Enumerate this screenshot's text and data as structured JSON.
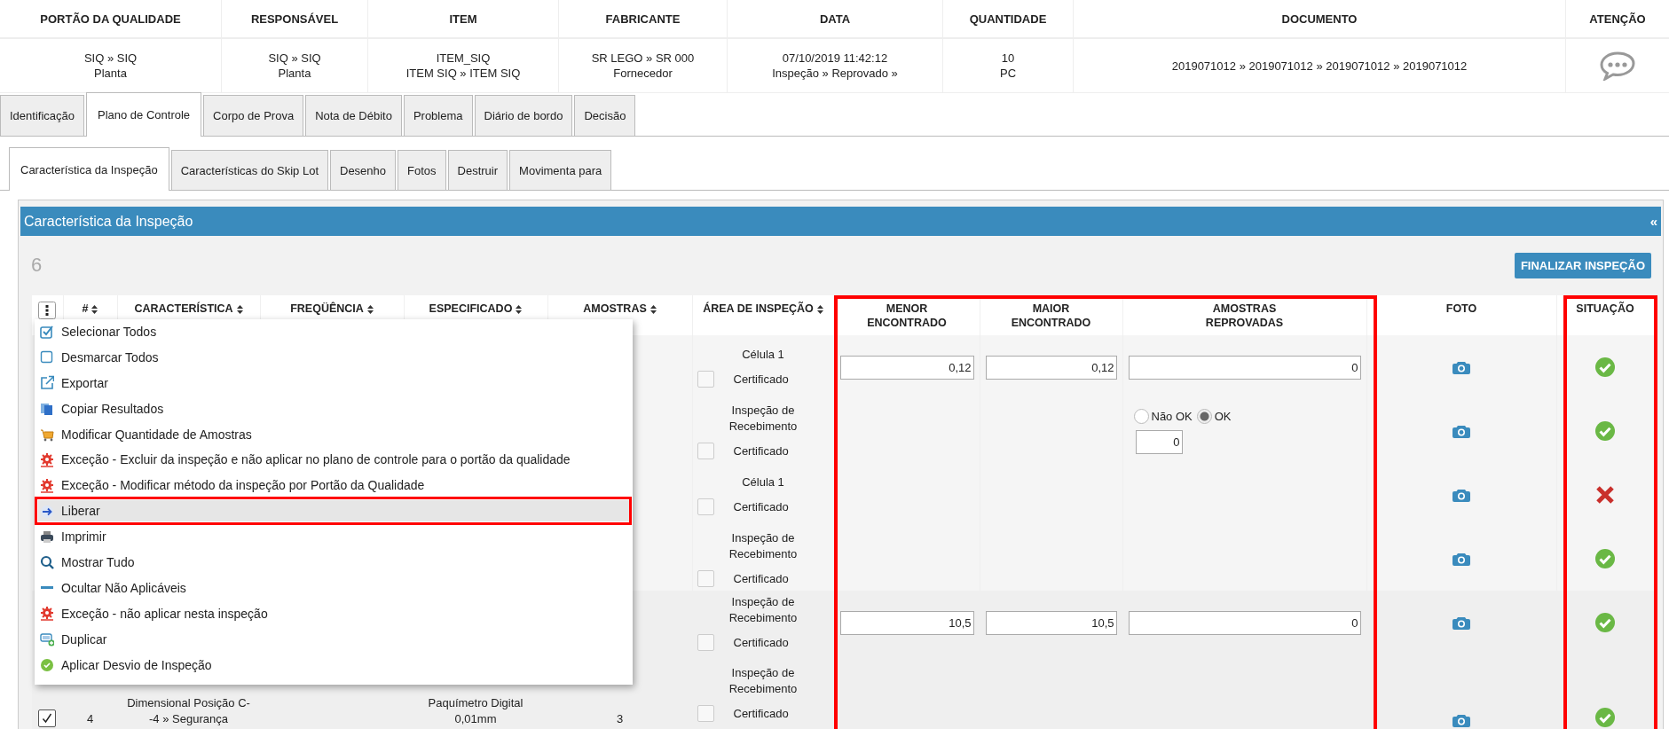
{
  "summary": [
    {
      "kind": "text",
      "label": "PORTÃO DA QUALIDADE",
      "lines": [
        "SIQ » SIQ",
        "Planta"
      ]
    },
    {
      "kind": "text",
      "label": "RESPONSÁVEL",
      "lines": [
        "SIQ » SIQ",
        "Planta"
      ]
    },
    {
      "kind": "text",
      "label": "ITEM",
      "lines": [
        "ITEM_SIQ",
        "ITEM SIQ » ITEM SIQ"
      ]
    },
    {
      "kind": "text",
      "label": "FABRICANTE",
      "lines": [
        "SR LEGO » SR 000",
        "Fornecedor"
      ]
    },
    {
      "kind": "text",
      "label": "DATA",
      "lines": [
        "07/10/2019 11:42:12",
        "Inspeção » Reprovado »"
      ]
    },
    {
      "kind": "text",
      "label": "QUANTIDADE",
      "lines": [
        "10",
        "PC"
      ]
    },
    {
      "kind": "text",
      "label": "DOCUMENTO",
      "lines": [
        "2019071012 » 2019071012 » 2019071012 » 2019071012"
      ]
    },
    {
      "kind": "alert",
      "label": "ATENÇÃO"
    }
  ],
  "tabs": [
    {
      "label": "Identificação",
      "selected": false
    },
    {
      "label": "Plano de Controle",
      "selected": true
    },
    {
      "label": "Corpo de Prova",
      "selected": false
    },
    {
      "label": "Nota de Débito",
      "selected": false
    },
    {
      "label": "Problema",
      "selected": false
    },
    {
      "label": "Diário de bordo",
      "selected": false
    },
    {
      "label": "Decisão",
      "selected": false
    }
  ],
  "subtabs": [
    {
      "label": "Característica da Inspeção",
      "selected": true
    },
    {
      "label": "Características do Skip Lot",
      "selected": false
    },
    {
      "label": "Desenho",
      "selected": false
    },
    {
      "label": "Fotos",
      "selected": false
    },
    {
      "label": "Destruir",
      "selected": false
    },
    {
      "label": "Movimenta para",
      "selected": false
    }
  ],
  "panel": {
    "title": "Característica da Inspeção",
    "collapse": "«",
    "count": "6",
    "finish_button": "FINALIZAR INSPEÇÃO"
  },
  "table": {
    "columns": [
      {
        "kind": "menu"
      },
      {
        "kind": "label",
        "label": "#",
        "sortable": true,
        "annotated": false
      },
      {
        "kind": "label",
        "label": "CARACTERÍSTICA",
        "sortable": true,
        "annotated": false
      },
      {
        "kind": "label",
        "label": "FREQÜÊNCIA",
        "sortable": true,
        "annotated": false
      },
      {
        "kind": "label",
        "label": "ESPECIFICADO",
        "sortable": true,
        "annotated": false
      },
      {
        "kind": "label",
        "label": "AMOSTRAS",
        "sortable": true,
        "annotated": false
      },
      {
        "kind": "label",
        "label": "ÁREA DE INSPEÇÃO",
        "sortable": true,
        "annotated": false
      },
      {
        "kind": "label",
        "label": "MENOR ENCONTRADO",
        "sortable": false,
        "annotated": true
      },
      {
        "kind": "label",
        "label": "MAIOR ENCONTRADO",
        "sortable": false,
        "annotated": true
      },
      {
        "kind": "label",
        "label": "AMOSTRAS REPROVADAS",
        "sortable": false,
        "annotated": true
      },
      {
        "kind": "label",
        "label": "FOTO",
        "sortable": false,
        "annotated": false
      },
      {
        "kind": "label",
        "label": "SITUAÇÃO",
        "sortable": false,
        "annotated": true
      }
    ],
    "rows": [
      {
        "kind": "numeric",
        "area": "Célula 1",
        "certificate": "Certificado",
        "certified": false,
        "min": "0,12",
        "max": "0,12",
        "rejected": "0",
        "approved": true
      },
      {
        "kind": "attribute",
        "area": "Inspeção de Recebimento",
        "certificate": "Certificado",
        "certified": false,
        "options": [
          {
            "label": "Não OK",
            "selected": false
          },
          {
            "label": "OK",
            "selected": true
          }
        ],
        "rejected": "0",
        "approved": true
      },
      {
        "kind": "blank",
        "area": "Célula 1",
        "certificate": "Certificado",
        "certified": false,
        "approved": false
      },
      {
        "kind": "blank",
        "area": "Inspeção de Recebimento",
        "certificate": "Certificado",
        "certified": false,
        "approved": true
      },
      {
        "kind": "numeric",
        "area": "Inspeção de Recebimento",
        "certificate": "Certificado",
        "certified": false,
        "min": "10,5",
        "max": "10,5",
        "rejected": "0",
        "approved": true
      },
      {
        "kind": "blank",
        "checked": true,
        "number": "4",
        "characteristic": [
          "Dimensional Posição C-",
          "-4 » Segurança"
        ],
        "specified": [
          "Paquímetro Digital",
          "0,01mm"
        ],
        "samples": "3",
        "area": "Inspeção de Recebimento",
        "certificate": "Certificado",
        "certified": false,
        "approved": true
      }
    ]
  },
  "menu": [
    {
      "kind": "select-all",
      "label": "Selecionar Todos",
      "selected": false,
      "annotated": false
    },
    {
      "kind": "deselect-all",
      "label": "Desmarcar Todos",
      "selected": false,
      "annotated": false
    },
    {
      "kind": "export",
      "label": "Exportar",
      "selected": false,
      "annotated": false
    },
    {
      "kind": "copy",
      "label": "Copiar Resultados",
      "selected": false,
      "annotated": false
    },
    {
      "kind": "quantity",
      "label": "Modificar Quantidade de Amostras",
      "selected": false,
      "annotated": false
    },
    {
      "kind": "exception",
      "label": "Exceção - Excluir da inspeção e não aplicar no plano de controle para o portão da qualidade",
      "selected": false,
      "annotated": false
    },
    {
      "kind": "exception",
      "label": "Exceção - Modificar método da inspeção por Portão da Qualidade",
      "selected": false,
      "annotated": false
    },
    {
      "kind": "release",
      "label": "Liberar",
      "selected": true,
      "annotated": true
    },
    {
      "kind": "print",
      "label": "Imprimir",
      "selected": false,
      "annotated": false
    },
    {
      "kind": "show",
      "label": "Mostrar Tudo",
      "selected": false,
      "annotated": false
    },
    {
      "kind": "hide",
      "label": "Ocultar Não Aplicáveis",
      "selected": false,
      "annotated": false
    },
    {
      "kind": "exception",
      "label": "Exceção - não aplicar nesta inspeção",
      "selected": false,
      "annotated": false
    },
    {
      "kind": "duplicate",
      "label": "Duplicar",
      "selected": false,
      "annotated": false
    },
    {
      "kind": "deviation",
      "label": "Aplicar Desvio de Inspeção",
      "selected": false,
      "annotated": false
    }
  ]
}
